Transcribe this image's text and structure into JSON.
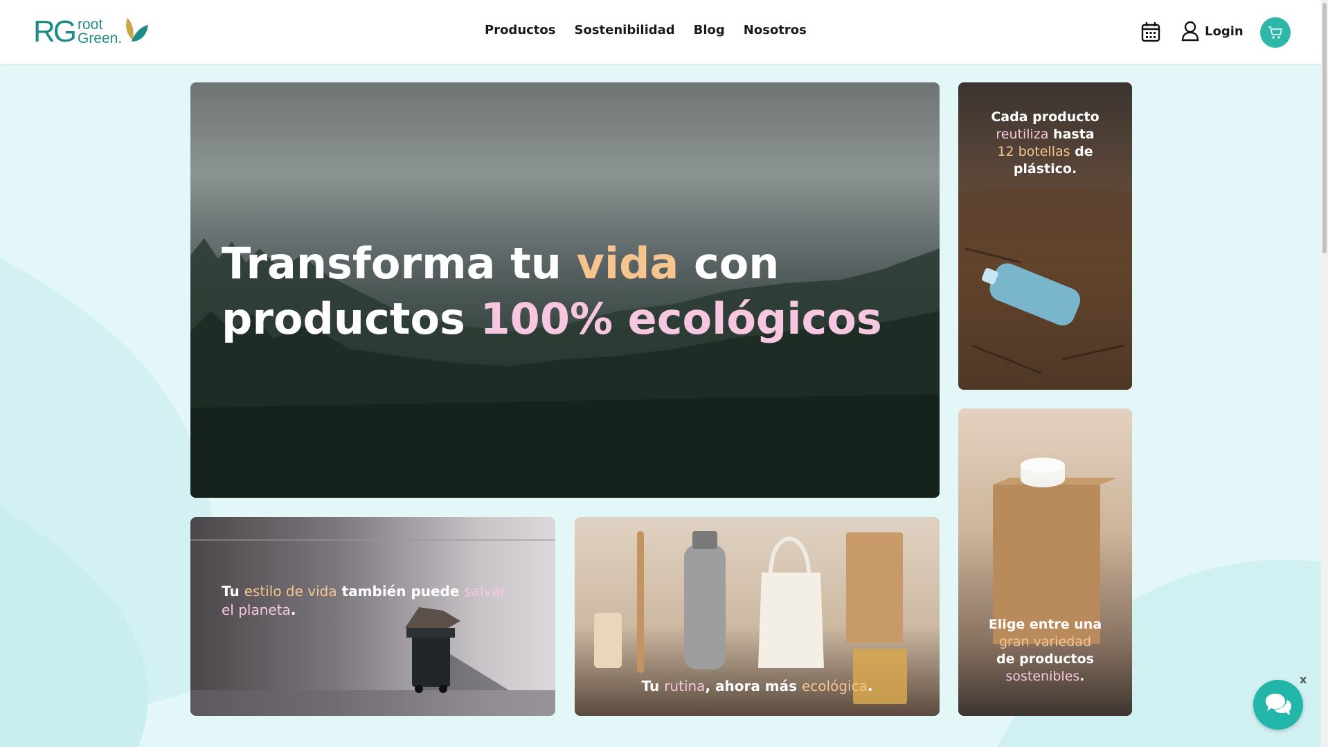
{
  "brand": {
    "initials": "RG",
    "line1": "root",
    "line2": "Green."
  },
  "nav": {
    "items": [
      "Productos",
      "Sostenibilidad",
      "Blog",
      "Nosotros"
    ]
  },
  "header": {
    "login_label": "Login"
  },
  "hero": {
    "title_parts": [
      "Transforma tu ",
      "vida",
      " con",
      "productos ",
      "100% ecológicos"
    ]
  },
  "bottle_card": {
    "parts": [
      "Cada producto",
      "reutiliza",
      " hasta",
      "12 botellas",
      " de",
      "plástico."
    ]
  },
  "carton_card": {
    "parts": [
      "Elige entre una",
      "gran variedad",
      "de productos",
      "sostenibles",
      "."
    ]
  },
  "trash_card": {
    "parts": [
      "Tu ",
      "estilo de vida",
      " también puede ",
      "salvar",
      "el planeta",
      "."
    ]
  },
  "products_card": {
    "parts": [
      "Tu ",
      "rutina",
      ", ahora más ",
      "ecológica",
      "."
    ]
  },
  "chat": {
    "close_label": "x"
  },
  "colors": {
    "brand": "#1f8b86",
    "accent": "#2eb7a8",
    "orange_text": "#f6c58f",
    "pink_text": "#f7c7e2",
    "page_bg": "#e3f7f8"
  }
}
